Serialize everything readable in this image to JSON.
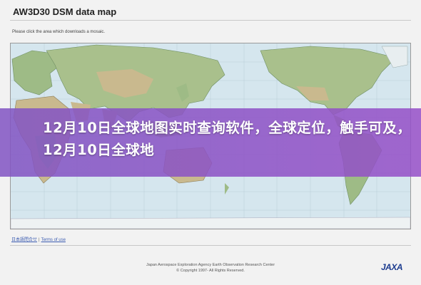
{
  "page": {
    "title": "AW3D30 DSM data map",
    "instruction": "Please click the area which downloads a mosaic."
  },
  "banner": {
    "text": "12月10日全球地图实时查询软件，全球定位，触手可及，12月10日全球地"
  },
  "footer": {
    "links": [
      "日本語問合せ",
      "Terms of use"
    ],
    "agency_line": "Japan Aerospace Exploration Agency  Earth Observation Research Center",
    "copyright": "© Copyright 1997- All Rights Reserved.",
    "logo_text": "JAXA"
  },
  "colors": {
    "ocean": "#d5e6ee",
    "land_green": "#9ebb86",
    "land_tan": "#c9b98e",
    "banner": "#8a55c6"
  }
}
